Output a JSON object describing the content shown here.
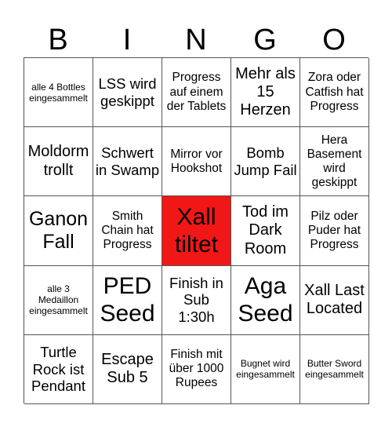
{
  "header": [
    "B",
    "I",
    "N",
    "G",
    "O"
  ],
  "free_color": "#f21717",
  "cells": [
    "alle 4 Bottles eingesammelt",
    "LSS wird geskippt",
    "Progress auf einem der Tablets",
    "Mehr als 15 Herzen",
    "Zora oder Catfish hat Progress",
    "Moldorm trollt",
    "Schwert in Swamp",
    "Mirror vor Hookshot",
    "Bomb Jump Fail",
    "Hera Basement wird geskippt",
    "Ganon Fall",
    "Smith Chain hat Progress",
    "Xall tiltet",
    "Tod im Dark Room",
    "Pilz oder Puder hat Progress",
    "alle 3 Medaillon eingesammelt",
    "PED Seed",
    "Finish in Sub 1:30h",
    "Aga Seed",
    "Xall Last Located",
    "Turtle Rock ist Pendant",
    "Escape Sub 5",
    "Finish mit über 1000 Rupees",
    "Bugnet wird eingesammelt",
    "Butter Sword eingesammelt"
  ]
}
